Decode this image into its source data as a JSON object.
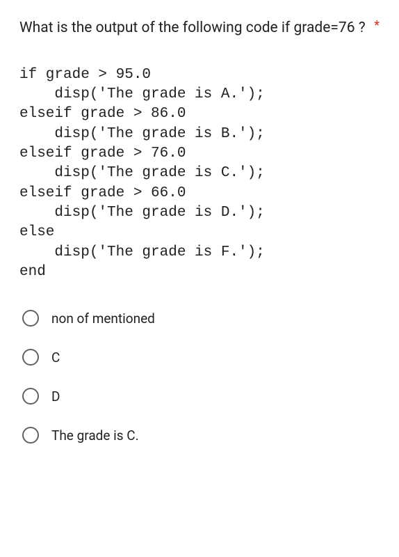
{
  "question": {
    "text": "What is the output of the following code if grade=76 ?",
    "required_marker": "*"
  },
  "code": "if grade > 95.0\n    disp('The grade is A.');\nelseif grade > 86.0\n    disp('The grade is B.');\nelseif grade > 76.0\n    disp('The grade is C.');\nelseif grade > 66.0\n    disp('The grade is D.');\nelse\n    disp('The grade is F.');\nend",
  "options": [
    {
      "label": "non of mentioned"
    },
    {
      "label": "C"
    },
    {
      "label": "D"
    },
    {
      "label": "The grade is C."
    }
  ]
}
